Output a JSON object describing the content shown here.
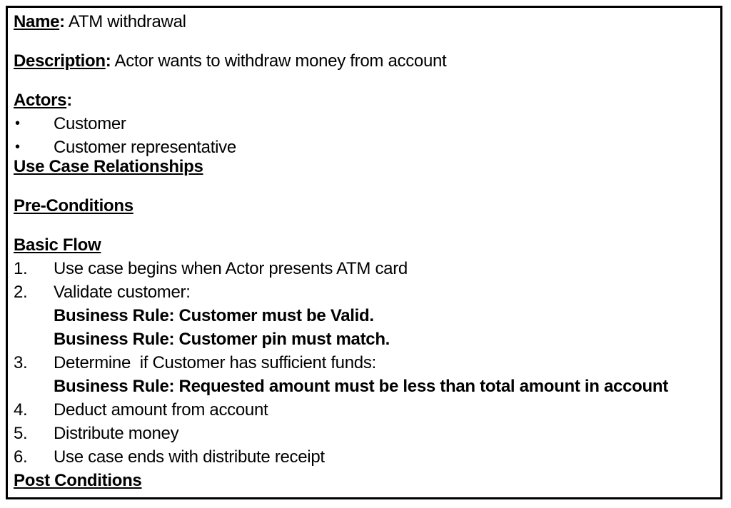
{
  "name": {
    "label": "Name",
    "separator": ":",
    "value": " ATM withdrawal"
  },
  "description": {
    "label": "Description",
    "separator": ":",
    "value": " Actor wants to withdraw money from account"
  },
  "actors": {
    "label": "Actors",
    "separator": ":",
    "bullet": "•",
    "items": [
      "Customer",
      "Customer representative"
    ]
  },
  "use_case_relationships": {
    "label": "Use Case Relationships"
  },
  "pre_conditions": {
    "label": "Pre-Conditions"
  },
  "basic_flow": {
    "label": "Basic Flow",
    "steps": [
      {
        "num": "1.",
        "text": "Use case begins when Actor presents ATM card"
      },
      {
        "num": "2.",
        "text": "Validate customer:"
      },
      {
        "num": "3.",
        "text": "Determine  if Customer has sufficient funds:"
      },
      {
        "num": "4.",
        "text": "Deduct amount from account"
      },
      {
        "num": "5.",
        "text": "Distribute money"
      },
      {
        "num": "6.",
        "text": "Use case ends with distribute receipt"
      }
    ],
    "rules": {
      "step2": [
        "Business Rule: Customer must be Valid.",
        "Business Rule: Customer pin must match."
      ],
      "step3": [
        "Business Rule: Requested amount must be less than total amount in account"
      ]
    }
  },
  "post_conditions": {
    "label": "Post Conditions"
  }
}
